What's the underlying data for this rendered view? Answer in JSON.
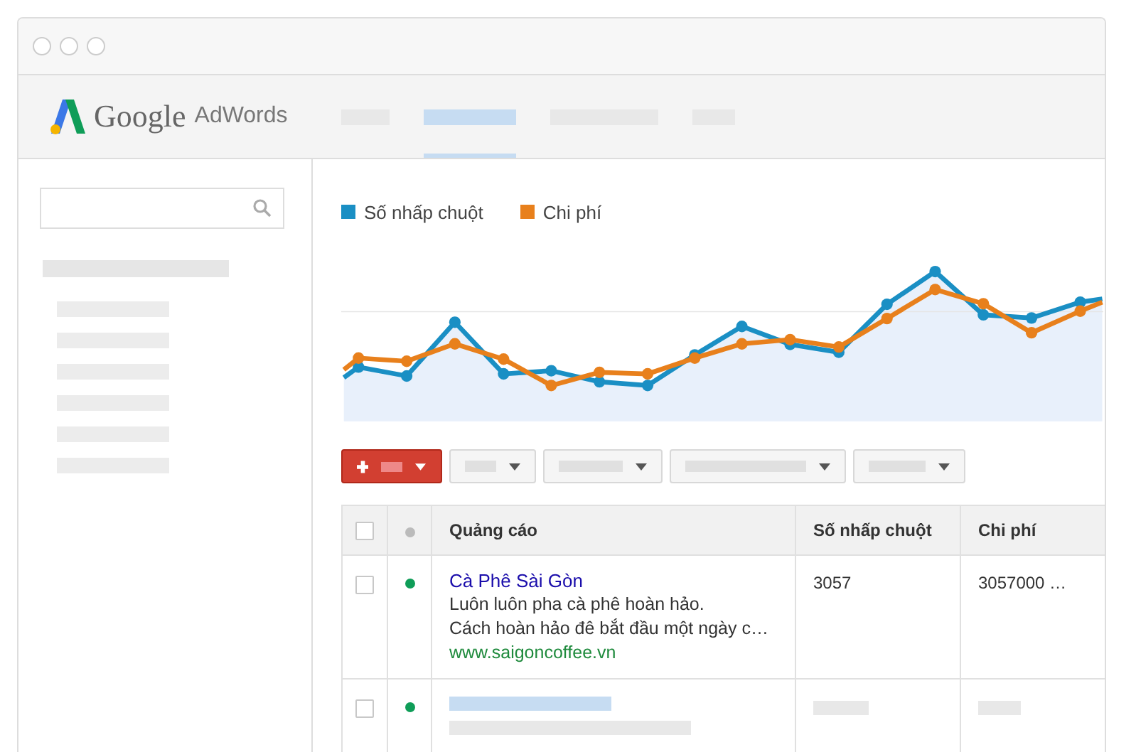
{
  "header": {
    "logo": {
      "brand": "Google",
      "product": "AdWords"
    },
    "tabs": [
      {
        "selected": false
      },
      {
        "selected": true
      },
      {
        "selected": false
      },
      {
        "selected": false
      }
    ]
  },
  "chart": {
    "legend": [
      {
        "label": "Số nhấp chuột",
        "color": "#1a8fc4"
      },
      {
        "label": "Chi phí",
        "color": "#e8801c"
      }
    ]
  },
  "table": {
    "header_checked": false,
    "columns": [
      "Quảng cáo",
      "Số nhấp chuột",
      "Chi phí"
    ],
    "rows": [
      {
        "kind": "ad",
        "checked": false,
        "color": "#0f9d58",
        "title": "Cà Phê Sài Gòn",
        "lines": [
          "Luôn luôn pha cà phê hoàn hảo.",
          "Cách hoàn hảo đê bắt đầu một ngày c…"
        ],
        "url": "www.saigoncoffee.vn",
        "clicks": "3057",
        "cost": "3057000 …"
      },
      {
        "kind": "placeholder",
        "checked": false,
        "color": "#0f9d58"
      }
    ]
  }
}
